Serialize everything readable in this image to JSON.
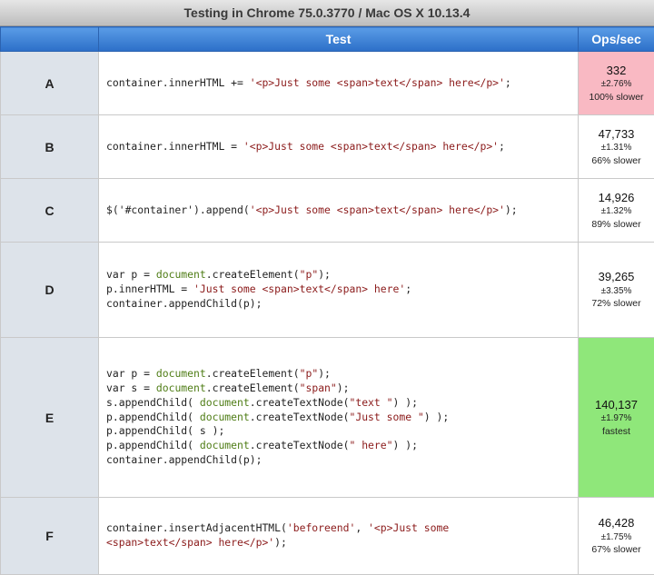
{
  "header": {
    "title": "Testing in Chrome 75.0.3770 / Mac OS X 10.13.4"
  },
  "columns": {
    "test": "Test",
    "ops": "Ops/sec"
  },
  "colors": {
    "slowest": "#f9b9c3",
    "fastest": "#8fe77a",
    "header_blue": "#3b7dd8"
  },
  "rows": [
    {
      "label": "A",
      "code": [
        [
          [
            "p",
            "container.innerHTML += "
          ],
          [
            "s",
            "'<p>Just some <span>text</span> here</p>'"
          ],
          [
            "p",
            ";"
          ]
        ]
      ],
      "ops": "332",
      "error": "±2.76%",
      "relative": "100% slower",
      "status": "slowest"
    },
    {
      "label": "B",
      "code": [
        [
          [
            "p",
            "container.innerHTML = "
          ],
          [
            "s",
            "'<p>Just some <span>text</span> here</p>'"
          ],
          [
            "p",
            ";"
          ]
        ]
      ],
      "ops": "47,733",
      "error": "±1.31%",
      "relative": "66% slower",
      "status": ""
    },
    {
      "label": "C",
      "code": [
        [
          [
            "p",
            "$('#container').append("
          ],
          [
            "s",
            "'<p>Just some <span>text</span> here</p>'"
          ],
          [
            "p",
            ");"
          ]
        ]
      ],
      "ops": "14,926",
      "error": "±1.32%",
      "relative": "89% slower",
      "status": ""
    },
    {
      "label": "D",
      "code": [
        [
          [
            "p",
            "var p = "
          ],
          [
            "f",
            "document"
          ],
          [
            "p",
            ".createElement("
          ],
          [
            "s",
            "\"p\""
          ],
          [
            "p",
            ");"
          ]
        ],
        [
          [
            "p",
            "p.innerHTML = "
          ],
          [
            "s",
            "'Just some <span>text</span> here'"
          ],
          [
            "p",
            ";"
          ]
        ],
        [
          [
            "p",
            "container.appendChild(p);"
          ]
        ]
      ],
      "ops": "39,265",
      "error": "±3.35%",
      "relative": "72% slower",
      "status": ""
    },
    {
      "label": "E",
      "code": [
        [
          [
            "p",
            "var p = "
          ],
          [
            "f",
            "document"
          ],
          [
            "p",
            ".createElement("
          ],
          [
            "s",
            "\"p\""
          ],
          [
            "p",
            ");"
          ]
        ],
        [
          [
            "p",
            "var s = "
          ],
          [
            "f",
            "document"
          ],
          [
            "p",
            ".createElement("
          ],
          [
            "s",
            "\"span\""
          ],
          [
            "p",
            ");"
          ]
        ],
        [
          [
            "p",
            "s.appendChild( "
          ],
          [
            "f",
            "document"
          ],
          [
            "p",
            ".createTextNode("
          ],
          [
            "s",
            "\"text \""
          ],
          [
            "p",
            ") );"
          ]
        ],
        [
          [
            "p",
            "p.appendChild( "
          ],
          [
            "f",
            "document"
          ],
          [
            "p",
            ".createTextNode("
          ],
          [
            "s",
            "\"Just some \""
          ],
          [
            "p",
            ") );"
          ]
        ],
        [
          [
            "p",
            "p.appendChild( s );"
          ]
        ],
        [
          [
            "p",
            "p.appendChild( "
          ],
          [
            "f",
            "document"
          ],
          [
            "p",
            ".createTextNode("
          ],
          [
            "s",
            "\" here\""
          ],
          [
            "p",
            ") );"
          ]
        ],
        [
          [
            "p",
            "container.appendChild(p);"
          ]
        ]
      ],
      "ops": "140,137",
      "error": "±1.97%",
      "relative": "fastest",
      "status": "fastest"
    },
    {
      "label": "F",
      "code": [
        [
          [
            "p",
            "container.insertAdjacentHTML("
          ],
          [
            "s",
            "'beforeend'"
          ],
          [
            "p",
            ", "
          ],
          [
            "s",
            "'<p>Just some"
          ]
        ],
        [
          [
            "s",
            "<span>text</span> here</p>'"
          ],
          [
            "p",
            ");"
          ]
        ]
      ],
      "ops": "46,428",
      "error": "±1.75%",
      "relative": "67% slower",
      "status": ""
    }
  ]
}
